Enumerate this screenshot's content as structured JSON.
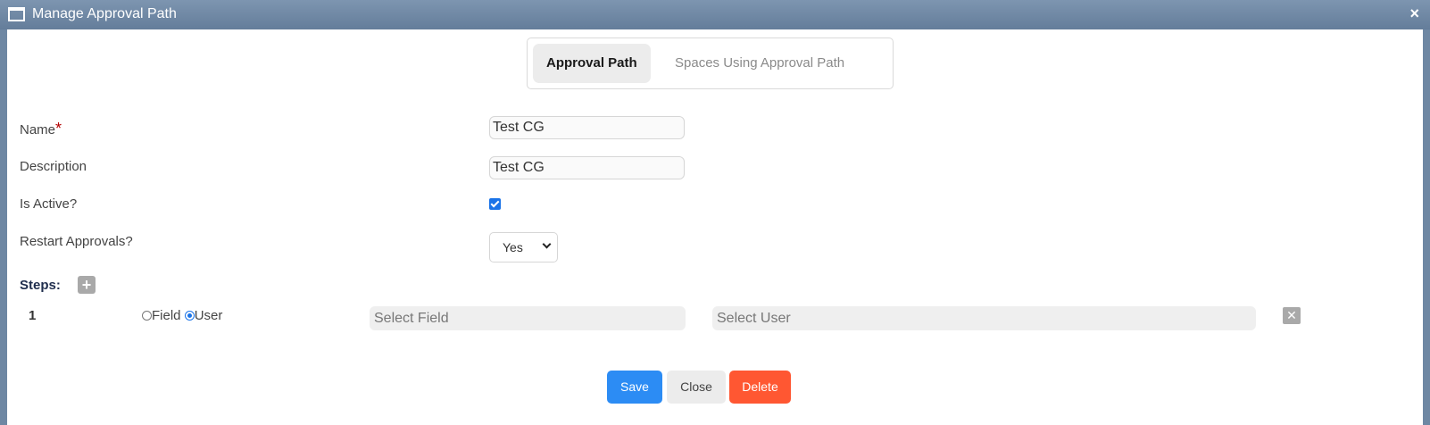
{
  "window": {
    "title": "Manage Approval Path",
    "close_glyph": "×"
  },
  "tabs": [
    {
      "label": "Approval Path",
      "active": true
    },
    {
      "label": "Spaces Using Approval Path",
      "active": false
    }
  ],
  "form": {
    "name_label": "Name",
    "required_mark": "*",
    "name_value": "Test CG",
    "description_label": "Description",
    "description_value": "Test CG",
    "is_active_label": "Is Active?",
    "is_active_checked": true,
    "restart_label": "Restart Approvals?",
    "restart_value": "Yes"
  },
  "steps": {
    "label": "Steps:",
    "add_glyph": "+",
    "items": [
      {
        "number": "1",
        "option_field": "Field",
        "option_user": "User",
        "selected": "User",
        "field_placeholder": "Select Field",
        "user_placeholder": "Select User",
        "remove_glyph": "✕"
      }
    ]
  },
  "buttons": {
    "save": "Save",
    "close": "Close",
    "delete": "Delete"
  },
  "colors": {
    "accent": "#2c8cf4",
    "danger": "#ff5732",
    "titlebar": "#6e87a3"
  }
}
